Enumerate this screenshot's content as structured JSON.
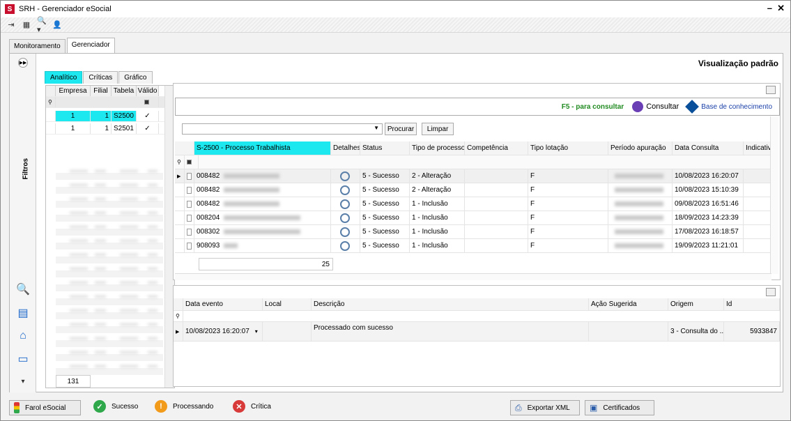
{
  "window": {
    "title": "SRH - Gerenciador eSocial",
    "minimize": "–",
    "close": "✕"
  },
  "main_tabs": [
    {
      "label": "Monitoramento"
    },
    {
      "label": "Gerenciador"
    }
  ],
  "view_title": "Visualização padrão",
  "left_sidebar": {
    "filters_label": "Filtros"
  },
  "sub_tabs": [
    {
      "label": "Analítico"
    },
    {
      "label": "Críticas"
    },
    {
      "label": "Gráfico"
    }
  ],
  "left_grid": {
    "headers": [
      "Empresa",
      "Filial",
      "Tabela",
      "Válido"
    ],
    "rows": [
      {
        "empresa": "1",
        "filial": "1",
        "tabela": "S2500",
        "valido": "✓"
      },
      {
        "empresa": "1",
        "filial": "1",
        "tabela": "S2501",
        "valido": "✓"
      }
    ],
    "count": "131"
  },
  "consult_bar": {
    "hint": "F5 - para consultar",
    "consult": "Consultar",
    "kb": "Base de conhecimento"
  },
  "search": {
    "procurar": "Procurar",
    "limpar": "Limpar"
  },
  "main_grid": {
    "group_header": "S-2500 - Processo Trabalhista",
    "headers": [
      "Detalhes",
      "Status",
      "Tipo de processo",
      "Competência",
      "Tipo lotação",
      "Período apuração",
      "Data Consulta",
      "Indicativ"
    ],
    "rows": [
      {
        "id": "008482",
        "status": "5 - Sucesso",
        "tipo": "2 - Alteração",
        "lotacao": "F",
        "data": "10/08/2023 16:20:07"
      },
      {
        "id": "008482",
        "status": "5 - Sucesso",
        "tipo": "2 - Alteração",
        "lotacao": "F",
        "data": "10/08/2023 15:10:39"
      },
      {
        "id": "008482",
        "status": "5 - Sucesso",
        "tipo": "1 - Inclusão",
        "lotacao": "F",
        "data": "09/08/2023 16:51:46"
      },
      {
        "id": "008204",
        "status": "5 - Sucesso",
        "tipo": "1 - Inclusão",
        "lotacao": "F",
        "data": "18/09/2023 14:23:39"
      },
      {
        "id": "008302",
        "status": "5 - Sucesso",
        "tipo": "1 - Inclusão",
        "lotacao": "F",
        "data": "17/08/2023 16:18:57"
      },
      {
        "id": "908093",
        "status": "5 - Sucesso",
        "tipo": "1 - Inclusão",
        "lotacao": "F",
        "data": "19/09/2023 11:21:01"
      }
    ],
    "count": "25"
  },
  "bottom_grid": {
    "headers": [
      "Data evento",
      "Local",
      "Descrição",
      "Ação Sugerida",
      "Origem",
      "Id"
    ],
    "row": {
      "data": "10/08/2023 16:20:07",
      "descricao": "Processado com sucesso",
      "origem": "3 - Consulta do ...",
      "id": "5933847"
    }
  },
  "status_bar": {
    "farol": "Farol eSocial",
    "sucesso": "Sucesso",
    "processando": "Processando",
    "critica": "Crítica",
    "exportar": "Exportar XML",
    "certificados": "Certificados"
  },
  "colors": {
    "highlight": "#1ee8ef",
    "success": "#2ea84a",
    "warning": "#f29a1a",
    "error": "#d83a3a",
    "link": "#1a40a8"
  }
}
